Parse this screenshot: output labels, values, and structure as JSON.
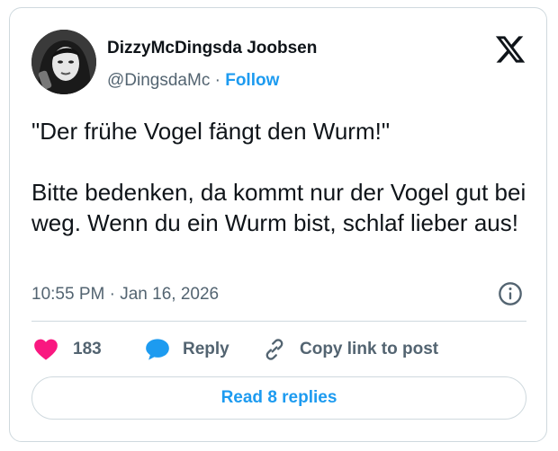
{
  "author": {
    "display_name": "DizzyMcDingsda Joobsen",
    "handle": "@DingsdaMc",
    "separator": "·",
    "follow_label": "Follow"
  },
  "tweet": {
    "paragraphs": [
      "\"Der frühe Vogel fängt den Wurm!\"",
      "Bitte bedenken, da kommt nur der Vogel gut bei weg. Wenn du ein Wurm bist, schlaf lieber aus!"
    ],
    "timestamp": "10:55 PM · Jan 16, 2026"
  },
  "actions": {
    "like_count": "183",
    "reply_label": "Reply",
    "copy_link_label": "Copy link to post"
  },
  "read_replies_label": "Read 8 replies",
  "icons": {
    "brand": "x-logo-icon",
    "info": "info-icon",
    "like": "heart-icon",
    "reply": "speech-bubble-icon",
    "copy": "link-icon"
  },
  "colors": {
    "accent": "#1d9bf0",
    "like": "#f91880",
    "text": "#0f1419",
    "secondary": "#536471",
    "border": "#cfd9de"
  }
}
